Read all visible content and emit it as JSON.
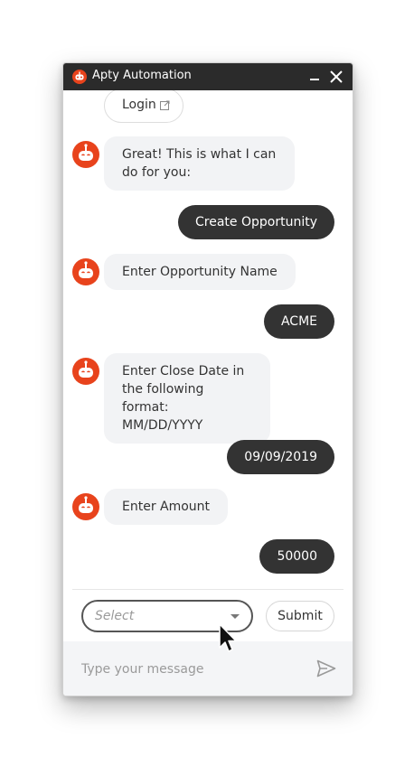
{
  "window": {
    "title": "Apty Automation"
  },
  "colors": {
    "titlebar": "#2b2b2b",
    "brand": "#e8431c",
    "bot_bubble": "#f2f3f5",
    "user_bubble": "#333333"
  },
  "chat": {
    "login_label": "Login",
    "messages": [
      {
        "from": "bot",
        "text": "Great! This is what I can do for you:"
      },
      {
        "from": "user",
        "text": "Create Opportunity"
      },
      {
        "from": "bot",
        "text": "Enter Opportunity Name"
      },
      {
        "from": "user",
        "text": "ACME"
      },
      {
        "from": "bot",
        "text": "Enter Close Date in the following format: MM/DD/YYYY"
      },
      {
        "from": "user",
        "text": "09/09/2019"
      },
      {
        "from": "bot",
        "text": "Enter Amount"
      },
      {
        "from": "user",
        "text": "50000"
      }
    ]
  },
  "form": {
    "select_placeholder": "Select",
    "submit_label": "Submit"
  },
  "composer": {
    "placeholder": "Type your message"
  },
  "icons": {
    "logo": "robot-icon",
    "minimize": "minimize-icon",
    "close": "close-icon",
    "external": "external-link-icon",
    "send": "send-icon"
  }
}
